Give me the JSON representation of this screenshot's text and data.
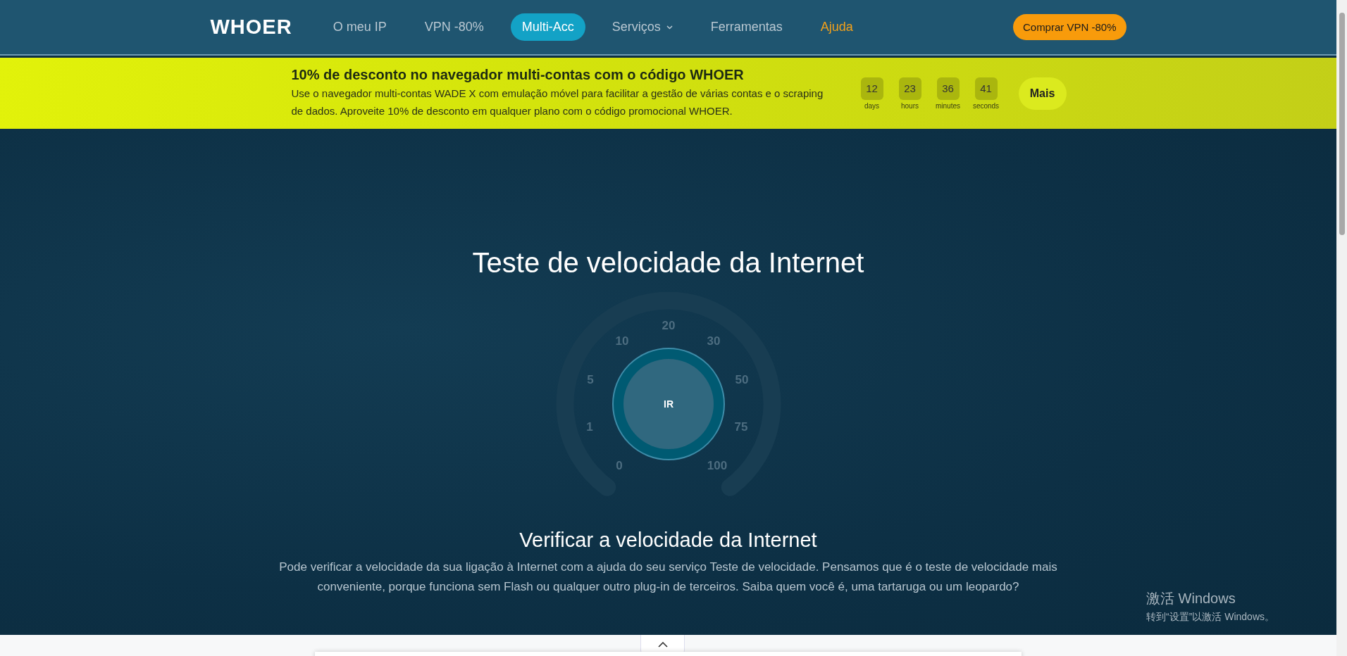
{
  "header": {
    "logo": "WHOER",
    "nav": [
      {
        "label": "O meu IP",
        "kind": "link",
        "selected": false,
        "highlighted": false
      },
      {
        "label": "VPN -80%",
        "kind": "link",
        "selected": false,
        "highlighted": false
      },
      {
        "label": "Multi-Acc",
        "kind": "link",
        "selected": true,
        "highlighted": false
      },
      {
        "label": "Serviços",
        "kind": "dropdown",
        "selected": false,
        "highlighted": false
      },
      {
        "label": "Ferramentas",
        "kind": "link",
        "selected": false,
        "highlighted": false
      },
      {
        "label": "Ajuda",
        "kind": "link",
        "selected": false,
        "highlighted": true
      }
    ],
    "cta": "Comprar VPN -80%"
  },
  "banner": {
    "title": "10% de desconto no navegador multi-contas com o código WHOER",
    "description": "Use o navegador multi-contas WADE X com emulação móvel para facilitar a gestão de várias contas e o scraping de dados. Aproveite 10% de desconto em qualquer plano com o código promocional WHOER.",
    "countdown": [
      {
        "value": "12",
        "unit": "days"
      },
      {
        "value": "23",
        "unit": "hours"
      },
      {
        "value": "36",
        "unit": "minutes"
      },
      {
        "value": "41",
        "unit": "seconds"
      }
    ],
    "button": "Mais"
  },
  "main": {
    "title": "Teste de velocidade da Internet",
    "gauge": {
      "labels": [
        "0",
        "1",
        "5",
        "10",
        "20",
        "30",
        "50",
        "75",
        "100"
      ],
      "button": "IR"
    },
    "heading": "Verificar a velocidade da Internet",
    "paragraph": "Pode verificar a velocidade da sua ligação à Internet com a ajuda do seu serviço Teste de velocidade. Pensamos que é o teste de velocidade mais conveniente, porque funciona sem Flash ou qualquer outro plug-in de terceiros. Saiba quem você é, uma tartaruga ou um leopardo?"
  },
  "os_notice": {
    "title": "激活 Windows",
    "subtitle": "转到“设置”以激活 Windows。"
  }
}
